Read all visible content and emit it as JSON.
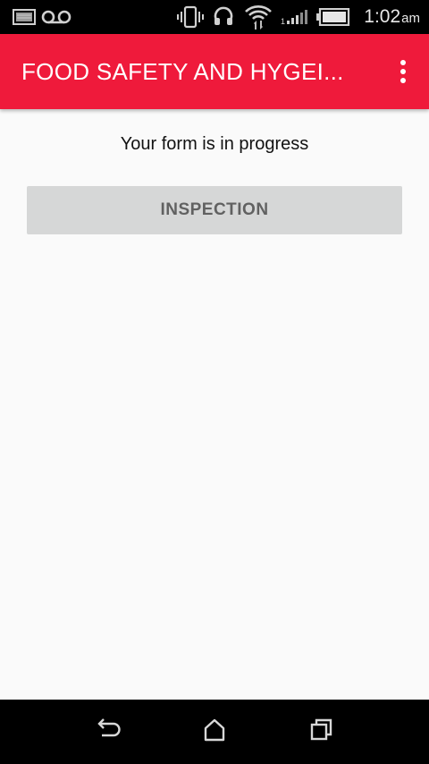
{
  "status_bar": {
    "time": "1:02",
    "ampm": "am",
    "icons": [
      "image-notification-icon",
      "voicemail-icon",
      "vibrate-icon",
      "sync-icon",
      "wifi-icon",
      "signal-icon",
      "battery-icon"
    ]
  },
  "app_bar": {
    "title": "FOOD SAFETY AND HYGEI...",
    "background_color": "#ef1a3b"
  },
  "main": {
    "progress_text": "Your form is in progress",
    "inspection_button_label": "INSPECTION"
  },
  "nav_bar": {
    "buttons": [
      "back-icon",
      "home-icon",
      "recents-icon"
    ]
  }
}
